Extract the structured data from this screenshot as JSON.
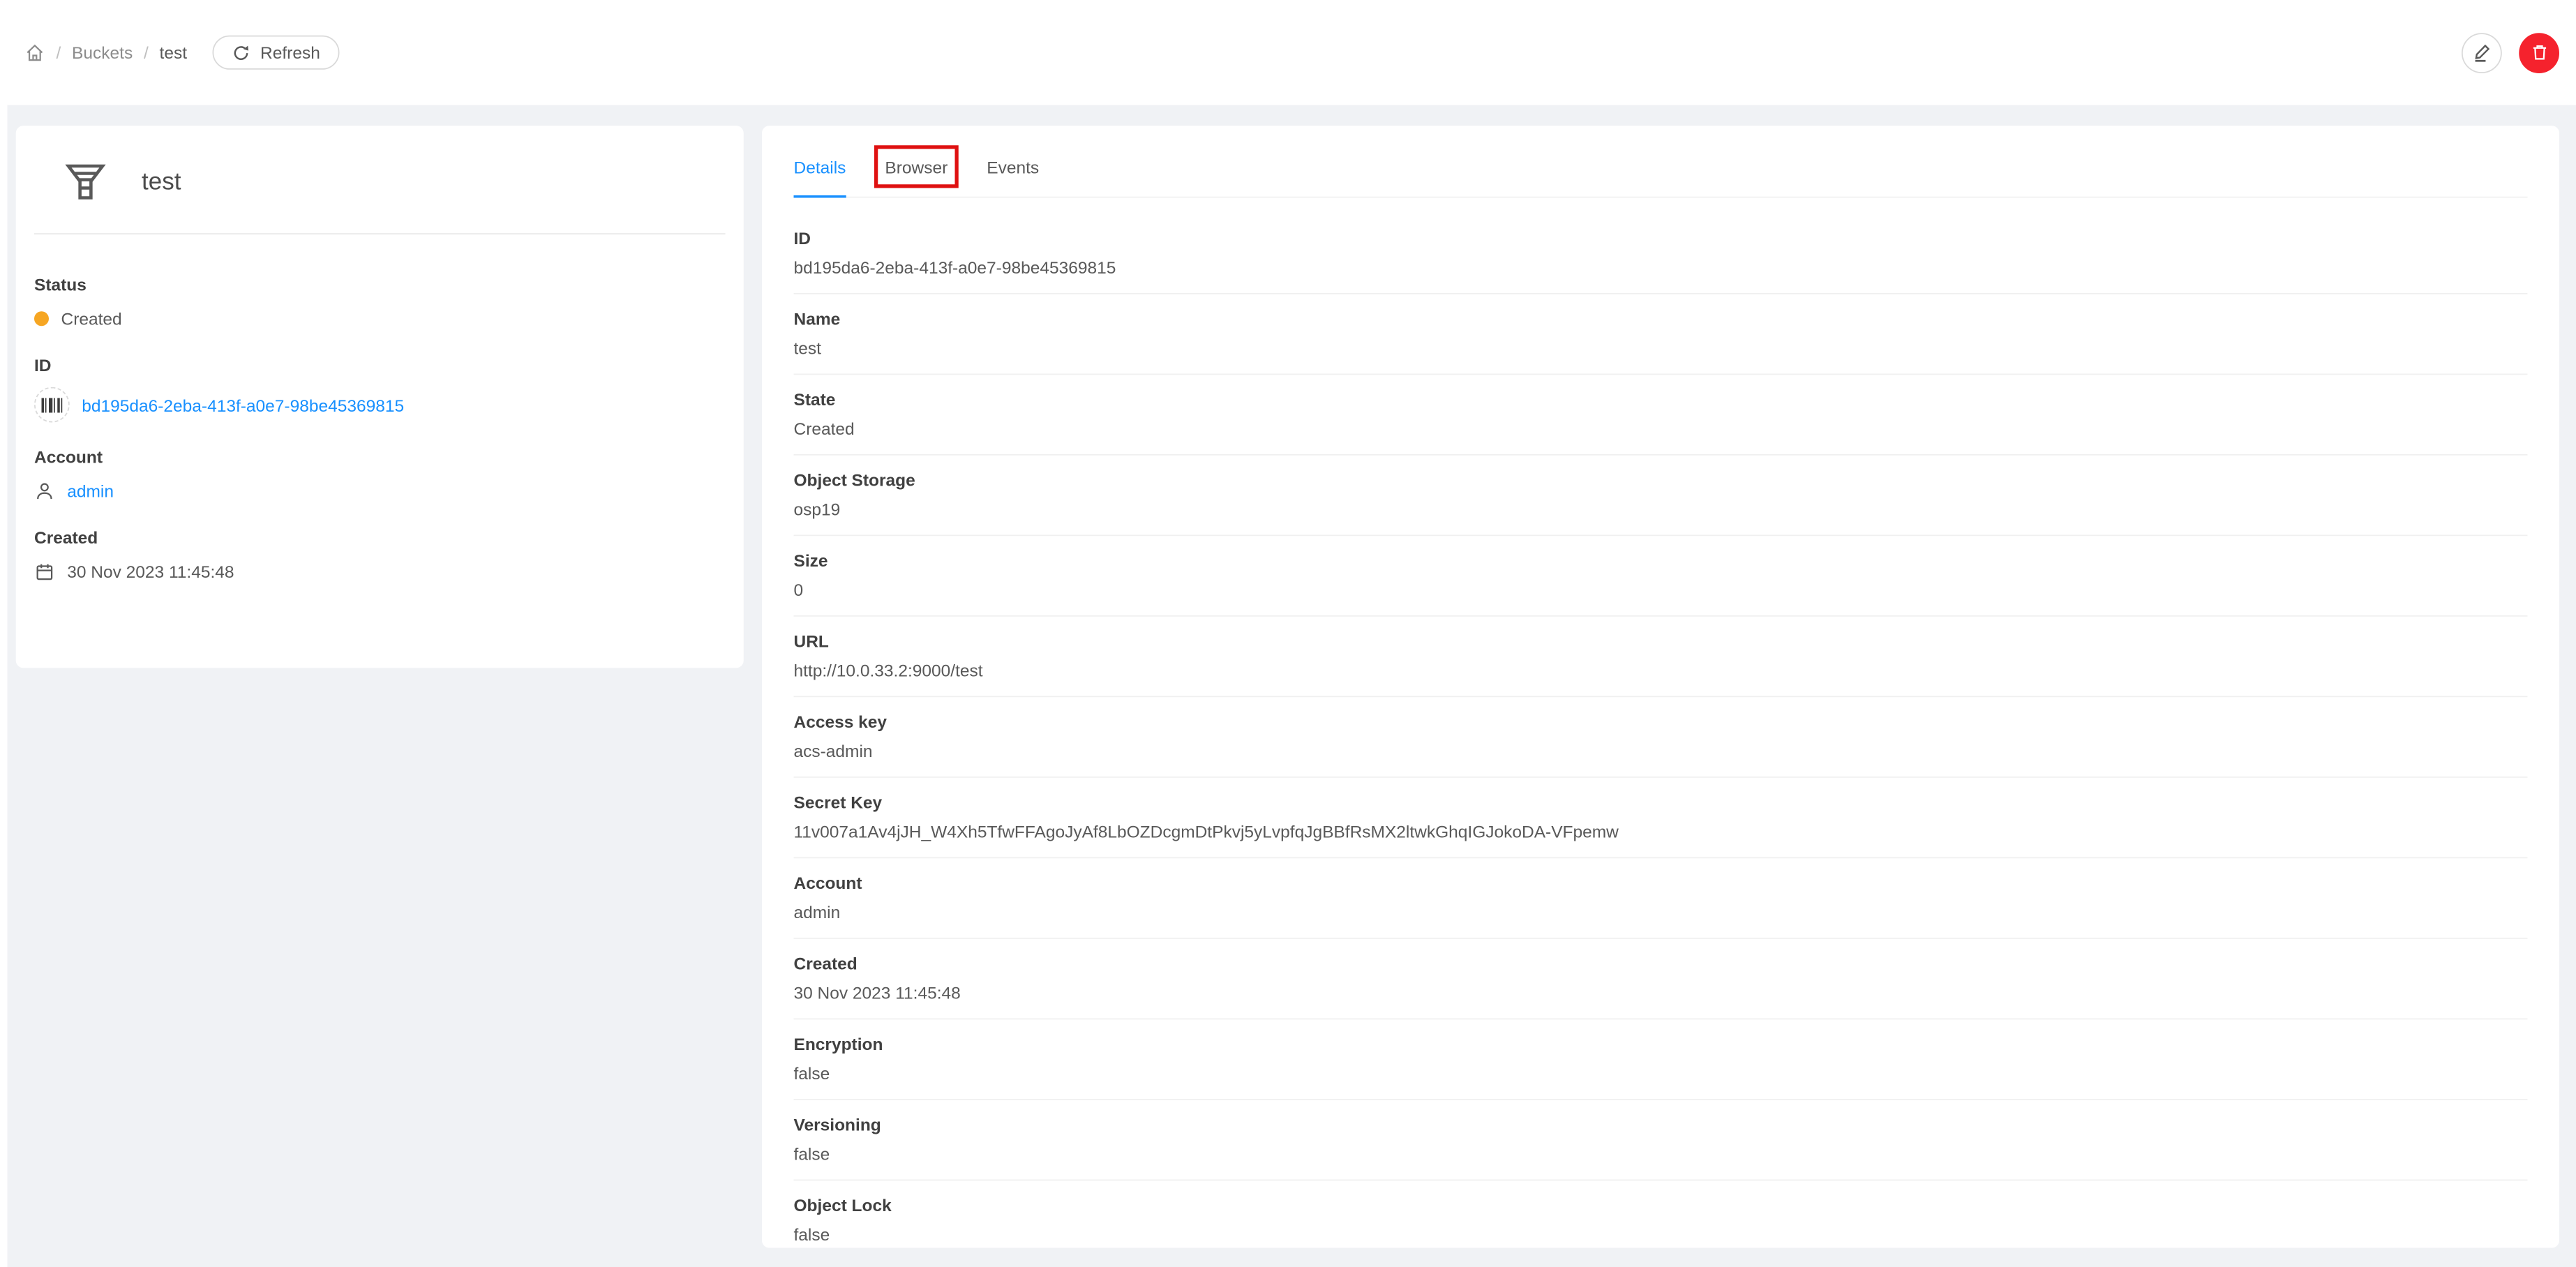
{
  "header": {
    "breadcrumb": {
      "home_icon": "home-icon",
      "separator": "/",
      "items": [
        "Buckets",
        "test"
      ]
    },
    "refresh_button": {
      "label": "Refresh",
      "icon": "reload-icon"
    },
    "actions": {
      "edit_icon": "pencil-icon",
      "delete_icon": "trash-icon"
    }
  },
  "info_card": {
    "icon": "bucket-funnel-icon",
    "title": "test",
    "fields": [
      {
        "label": "Status",
        "value": "Created",
        "icon": "status-dot",
        "value_type": "status"
      },
      {
        "label": "ID",
        "value": "bd195da6-2eba-413f-a0e7-98be45369815",
        "icon": "barcode-icon",
        "value_type": "link"
      },
      {
        "label": "Account",
        "value": "admin",
        "icon": "user-icon",
        "value_type": "link"
      },
      {
        "label": "Created",
        "value": "30 Nov 2023 11:45:48",
        "icon": "calendar-icon",
        "value_type": "text"
      }
    ]
  },
  "tabs": [
    {
      "label": "Details",
      "active": true,
      "annotated": false
    },
    {
      "label": "Browser",
      "active": false,
      "annotated": true
    },
    {
      "label": "Events",
      "active": false,
      "annotated": false
    }
  ],
  "details": {
    "rows": [
      {
        "label": "ID",
        "value": "bd195da6-2eba-413f-a0e7-98be45369815"
      },
      {
        "label": "Name",
        "value": "test"
      },
      {
        "label": "State",
        "value": "Created"
      },
      {
        "label": "Object Storage",
        "value": "osp19"
      },
      {
        "label": "Size",
        "value": "0"
      },
      {
        "label": "URL",
        "value": "http://10.0.33.2:9000/test"
      },
      {
        "label": "Access key",
        "value": "acs-admin"
      },
      {
        "label": "Secret Key",
        "value": "11v007a1Av4jJH_W4Xh5TfwFFAgoJyAf8LbOZDcgmDtPkvj5yLvpfqJgBBfRsMX2ltwkGhqIGJokoDA-VFpemw"
      },
      {
        "label": "Account",
        "value": "admin"
      },
      {
        "label": "Created",
        "value": "30 Nov 2023 11:45:48"
      },
      {
        "label": "Encryption",
        "value": "false"
      },
      {
        "label": "Versioning",
        "value": "false"
      },
      {
        "label": "Object Lock",
        "value": "false"
      }
    ]
  },
  "colors": {
    "accent_blue": "#1890ff",
    "status_orange": "#f6a623",
    "danger_red": "#f5222d",
    "annotation_red": "#df1111",
    "background": "#f0f2f5"
  }
}
